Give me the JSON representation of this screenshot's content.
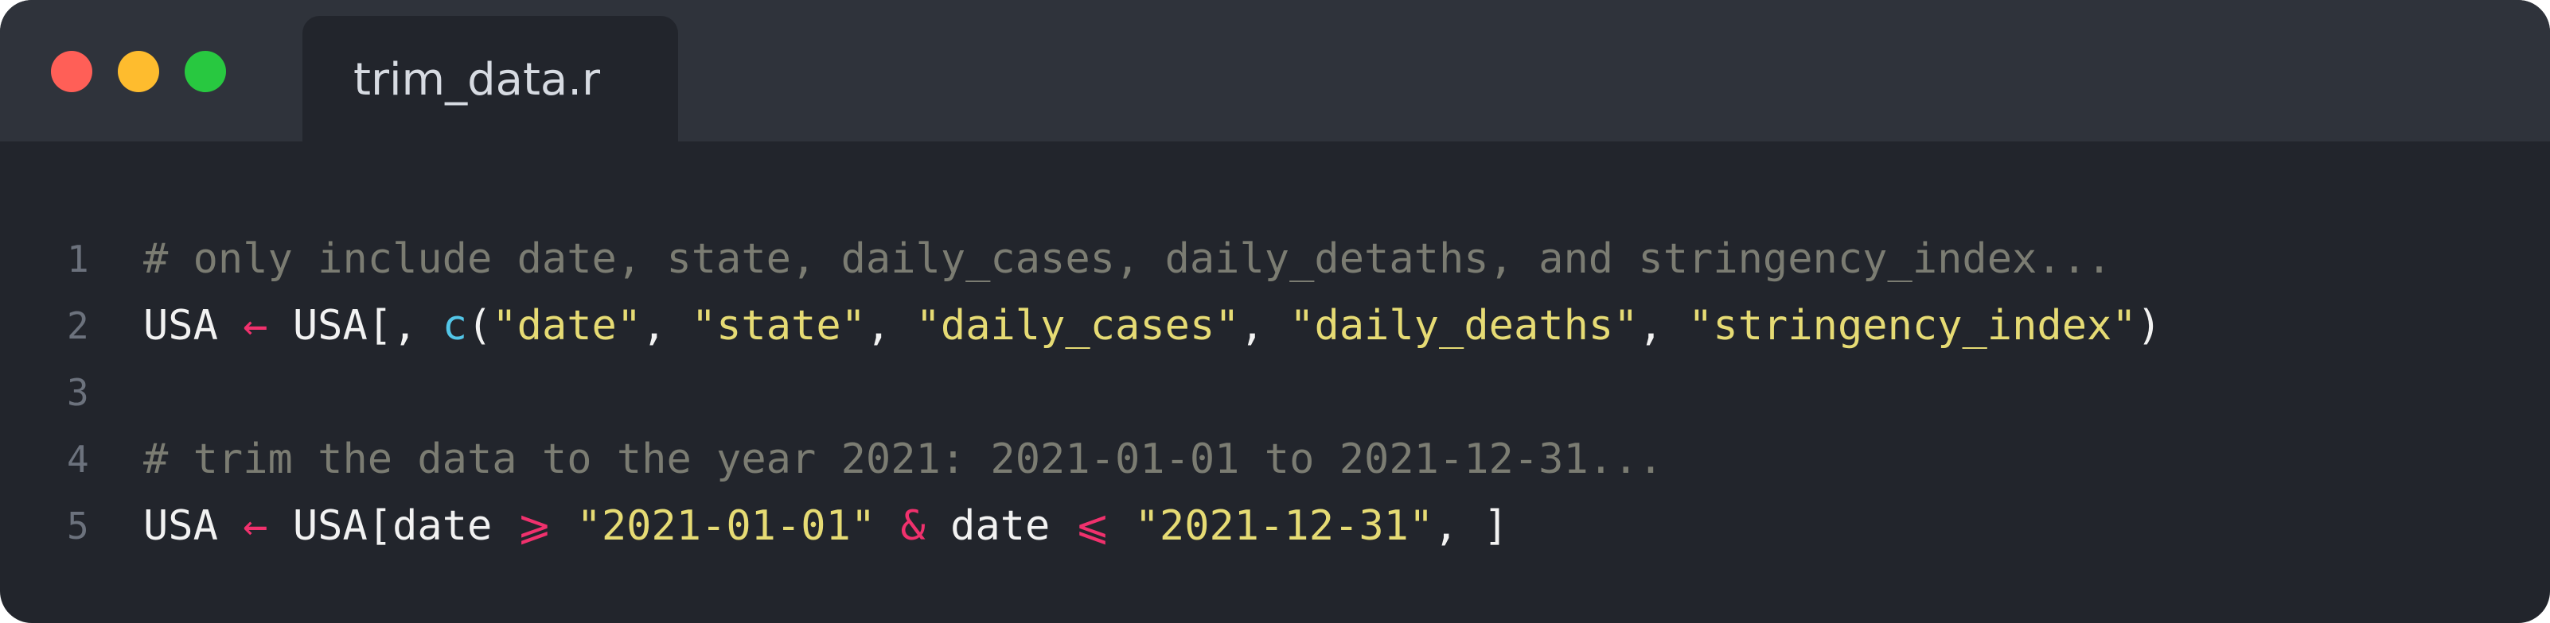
{
  "window": {
    "tab_title": "trim_data.r"
  },
  "editor": {
    "lines": [
      {
        "number": "1",
        "comment": "# only include date, state, daily_cases, daily_detaths, and stringency_index..."
      },
      {
        "number": "2",
        "var": "USA",
        "arrow": "←",
        "index_open": "USA[, ",
        "fn": "c",
        "paren_open": "(",
        "s1": "\"date\"",
        "comma1": ", ",
        "s2": "\"state\"",
        "comma2": ", ",
        "s3": "\"daily_cases\"",
        "comma3": ", ",
        "s4": "\"daily_deaths\"",
        "comma4": ", ",
        "s5": "\"stringency_index\"",
        "paren_close": ")"
      },
      {
        "number": "3"
      },
      {
        "number": "4",
        "comment": "# trim the data to the year 2021: 2021-01-01 to 2021-12-31..."
      },
      {
        "number": "5",
        "var": "USA",
        "arrow": "←",
        "index_open": "USA[date ",
        "ge": "⩾",
        "s1": "\"2021-01-01\"",
        "and": "&",
        "date2": "date",
        "le": "⩽",
        "s2": "\"2021-12-31\"",
        "close": ", ]"
      }
    ]
  }
}
